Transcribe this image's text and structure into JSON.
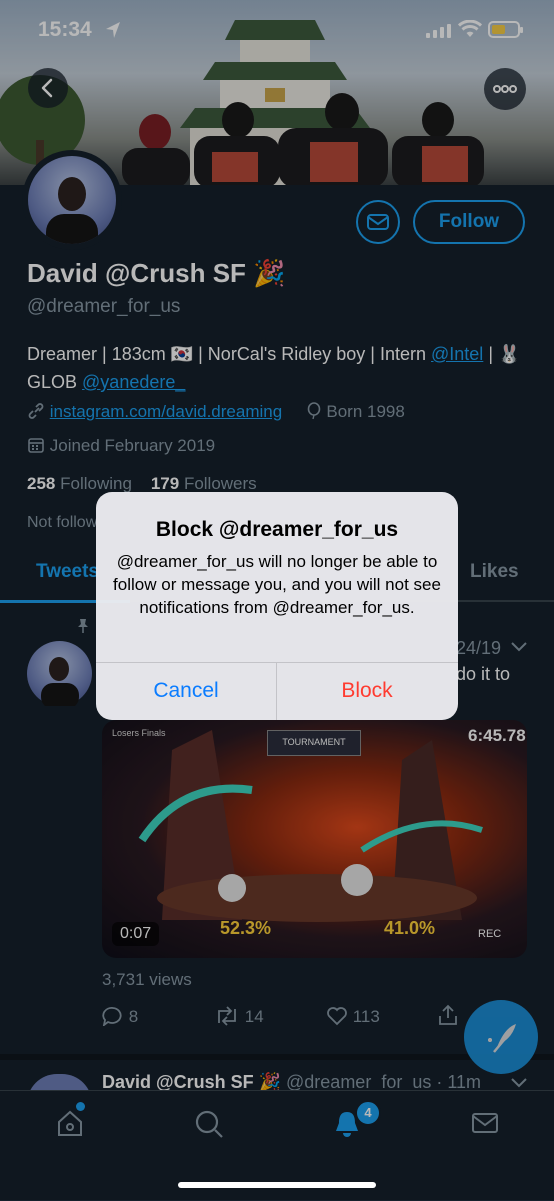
{
  "status_bar": {
    "time": "15:34"
  },
  "profile": {
    "name": "David @Crush SF 🎉",
    "handle": "@dreamer_for_us",
    "follow_label": "Follow",
    "bio_text": "Dreamer | 183cm 🇰🇷 | NorCal's Ridley boy | Intern ",
    "bio_link1": "@Intel",
    "bio_text2": " | 🐰 GLOB ",
    "bio_link2": "@yanedere_",
    "website": "instagram.com/david.dreaming",
    "born": "Born 1998",
    "joined": "Joined February 2019",
    "following_count": "258",
    "following_label": "Following",
    "followers_count": "179",
    "followers_label": "Followers",
    "not_followed": "Not follow"
  },
  "tabs": [
    {
      "label": "Tweets"
    },
    {
      "label": "Likes"
    }
  ],
  "tweet": {
    "date": "24/19",
    "text": "do it to",
    "video": {
      "top_left": "Losers Finals",
      "banner": "TOURNAMENT",
      "clock": "6:45.78",
      "duration": "0:07",
      "p1_percent": "52.3%",
      "p2_percent": "41.0%",
      "rec": "REC"
    },
    "views": "3,731 views",
    "replies": "8",
    "retweets": "14",
    "likes": "113"
  },
  "tweet2": {
    "name": "David @Crush SF 🎉",
    "handle": "@dreamer_for_us · 11m"
  },
  "nav": {
    "notifications_badge": "4"
  },
  "alert": {
    "title": "Block @dreamer_for_us",
    "message": "@dreamer_for_us will no longer be able to follow or message you, and you will not see notifications from @dreamer_for_us.",
    "cancel_label": "Cancel",
    "block_label": "Block"
  },
  "colors": {
    "accent": "#1da1f2",
    "background": "#15202b",
    "destructive": "#ff3b30",
    "ios_blue": "#0a7cff"
  }
}
